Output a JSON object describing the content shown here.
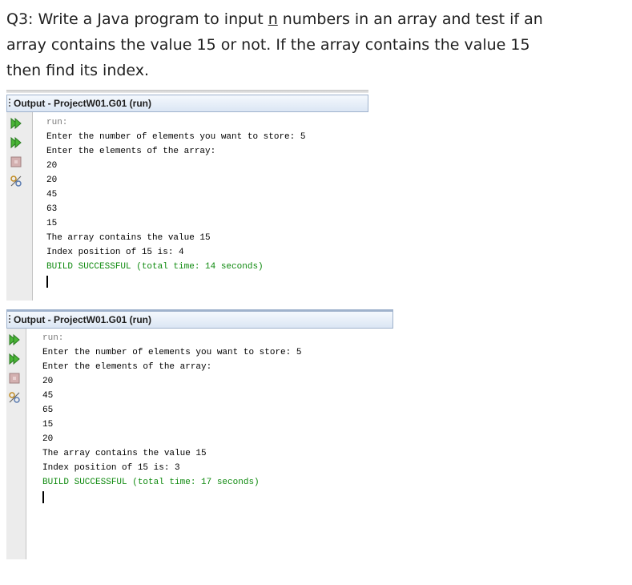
{
  "question": {
    "line1_before": "Q3: Write a Java program to input ",
    "line1_n": "n",
    "line1_after": " numbers in an array and test if an",
    "line2": "array contains the value 15 or not. If the array contains the value 15",
    "line3": "then find its index."
  },
  "panels": [
    {
      "title": "Output - ProjectW01.G01 (run)",
      "lines": {
        "run": "run:",
        "prompt_count": "Enter the number of elements you want to store: 5",
        "prompt_elements": "Enter the elements of the array:",
        "v1": "20",
        "v2": "20",
        "v3": "45",
        "v4": "63",
        "v5": "15",
        "result": "The array contains the value 15",
        "index": "Index position of 15 is: 4",
        "build": "BUILD SUCCESSFUL (total time: 14 seconds)"
      }
    },
    {
      "title": "Output - ProjectW01.G01 (run)",
      "lines": {
        "run": "run:",
        "prompt_count": "Enter the number of elements you want to store: 5",
        "prompt_elements": "Enter the elements of the array:",
        "v1": "20",
        "v2": "45",
        "v3": "65",
        "v4": "15",
        "v5": "20",
        "result": "The array contains the value 15",
        "index": "Index position of 15 is: 3",
        "build": "BUILD SUCCESSFUL (total time: 17 seconds)"
      }
    }
  ],
  "icons": [
    "rerun-icon",
    "rerun-with-options-icon",
    "stop-icon",
    "settings-icon"
  ],
  "colors": {
    "build_success": "#0f8a0f",
    "run_label": "#7a7a7a",
    "titlebar": "#dbe6f4"
  }
}
